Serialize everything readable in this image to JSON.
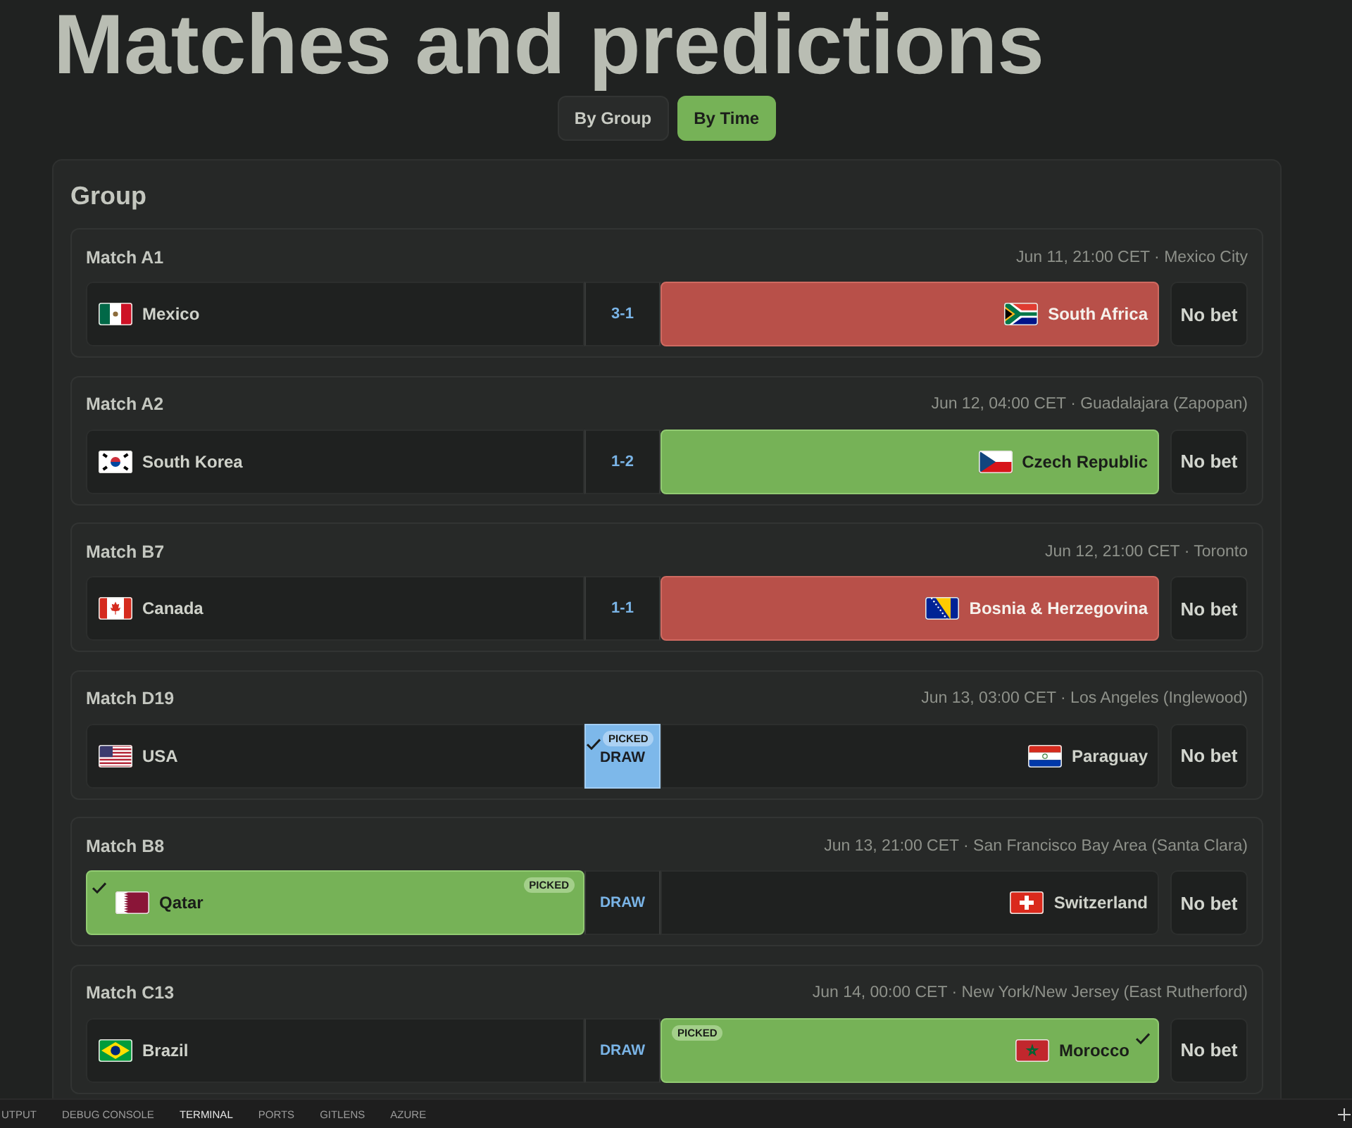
{
  "title": "Matches and predictions",
  "view_toggle": [
    {
      "label": "By Group",
      "selected": false
    },
    {
      "label": "By Time",
      "selected": true
    }
  ],
  "section": {
    "title": "Group",
    "matches": [
      {
        "name": "Match A1",
        "info": "Jun 11, 21:00 CET · Mexico City",
        "home": {
          "team": "Mexico",
          "flag": {
            "kind": "mx"
          },
          "selected": false
        },
        "middle": {
          "kind": "score",
          "label": "3-1",
          "selected": false
        },
        "away": {
          "team": "South Africa",
          "flag": {
            "kind": "za"
          },
          "selected": true,
          "correct": false
        },
        "bet": "No bet"
      },
      {
        "name": "Match A2",
        "info": "Jun 12, 04:00 CET · Guadalajara (Zapopan)",
        "home": {
          "team": "South Korea",
          "flag": {
            "kind": "kr"
          },
          "selected": false
        },
        "middle": {
          "kind": "score",
          "label": "1-2",
          "selected": false
        },
        "away": {
          "team": "Czech Republic",
          "flag": {
            "kind": "cz"
          },
          "selected": true,
          "correct": true
        },
        "bet": "No bet"
      },
      {
        "name": "Match B7",
        "info": "Jun 12, 21:00 CET · Toronto",
        "home": {
          "team": "Canada",
          "flag": {
            "kind": "ca"
          },
          "selected": false
        },
        "middle": {
          "kind": "score",
          "label": "1-1",
          "selected": false
        },
        "away": {
          "team": "Bosnia & Herzegovina",
          "flag": {
            "kind": "ba"
          },
          "selected": true,
          "correct": false
        },
        "bet": "No bet"
      },
      {
        "name": "Match D19",
        "info": "Jun 13, 03:00 CET · Los Angeles (Inglewood)",
        "home": {
          "team": "USA",
          "flag": {
            "kind": "us"
          },
          "selected": false
        },
        "middle": {
          "kind": "draw",
          "label": "DRAW",
          "selected": true,
          "badge": "PICKED"
        },
        "away": {
          "team": "Paraguay",
          "flag": {
            "kind": "py"
          },
          "selected": false
        },
        "bet": "No bet"
      },
      {
        "name": "Match B8",
        "info": "Jun 13, 21:00 CET · San Francisco Bay Area (Santa Clara)",
        "home": {
          "team": "Qatar",
          "flag": {
            "kind": "qa"
          },
          "selected": true,
          "badge": "PICKED"
        },
        "middle": {
          "kind": "draw",
          "label": "DRAW",
          "selected": false
        },
        "away": {
          "team": "Switzerland",
          "flag": {
            "kind": "ch"
          },
          "selected": false
        },
        "bet": "No bet"
      },
      {
        "name": "Match C13",
        "info": "Jun 14, 00:00 CET · New York/New Jersey (East Rutherford)",
        "home": {
          "team": "Brazil",
          "flag": {
            "kind": "br"
          },
          "selected": false
        },
        "middle": {
          "kind": "draw",
          "label": "DRAW",
          "selected": false
        },
        "away": {
          "team": "Morocco",
          "flag": {
            "kind": "ma"
          },
          "selected": true,
          "badge": "PICKED"
        },
        "bet": "No bet"
      }
    ]
  },
  "panel_tabs": [
    {
      "label": "UTPUT",
      "selected": false
    },
    {
      "label": "DEBUG CONSOLE",
      "selected": false
    },
    {
      "label": "TERMINAL",
      "selected": true
    },
    {
      "label": "PORTS",
      "selected": false
    },
    {
      "label": "GITLENS",
      "selected": false
    },
    {
      "label": "AZURE",
      "selected": false
    }
  ]
}
